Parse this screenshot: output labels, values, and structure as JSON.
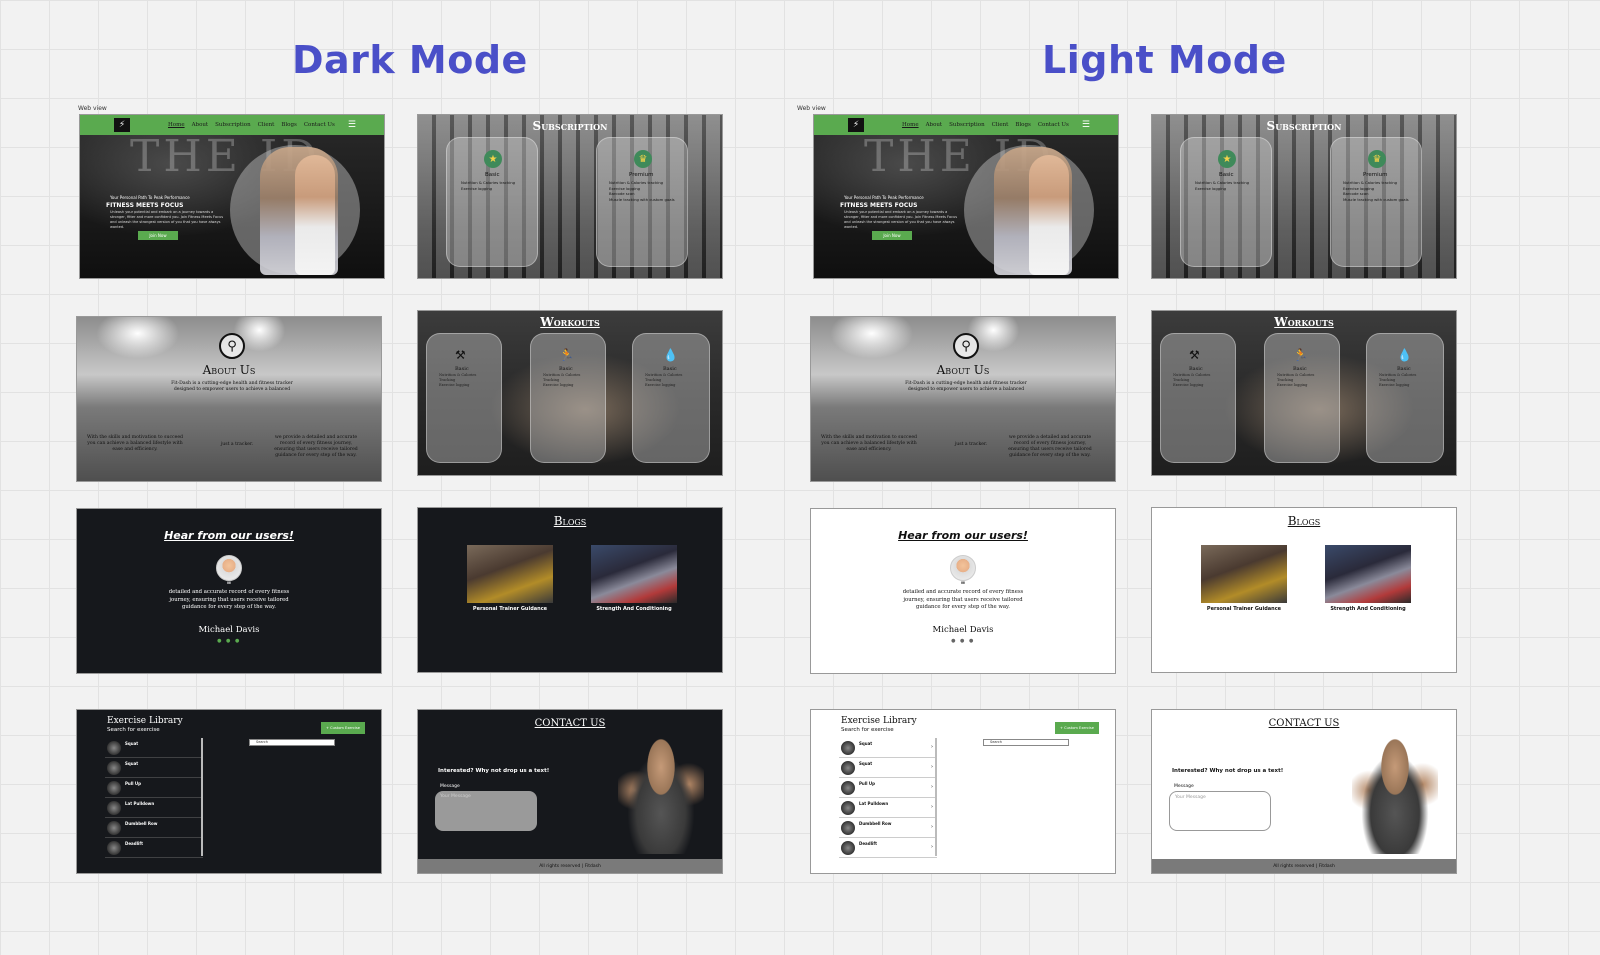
{
  "headings": {
    "dark": "Dark Mode",
    "light": "Light Mode"
  },
  "web_view_label": "Web view",
  "hero": {
    "nav_links": [
      "Home",
      "About",
      "Subscription",
      "Client",
      "Blogs",
      "Contact Us"
    ],
    "menu_icon": "☰",
    "big_text": "THE ID",
    "tagline": "Your Personal Path To Peak Performance",
    "headline": "FITNESS MEETS FOCUS",
    "body": "Unleash your potential and embark on a journey towards a stronger, fitter and more confident you. Join Fitness Meets Focus and unleash the strongest version of you that you have always wanted.",
    "button": "Join Now"
  },
  "subscription": {
    "title": "Subscription",
    "plans": [
      {
        "name": "Basic",
        "features": [
          "Nutrition & Calories tracking",
          "Exercise logging"
        ]
      },
      {
        "name": "Premium",
        "features": [
          "Nutrition & Calories tracking",
          "Exercise logging",
          "Barcode scan",
          "Muscle tracking with custom goals"
        ]
      }
    ]
  },
  "about": {
    "title": "About Us",
    "line1": "Fit-Dash is a cutting-edge health and fitness tracker",
    "line2": "designed to empower users to achieve a balanced",
    "left_text": "With the skills and motivation to succeed you can achieve a balanced lifestyle with ease and efficiency.",
    "middle_text": "just a tracker.",
    "right_text": "we provide a detailed and accurate record of every fitness journey, ensuring that users receive tailored guidance for every step of the way."
  },
  "workouts": {
    "title": "Workouts",
    "cards": [
      {
        "name": "Basic",
        "features": [
          "Nutrition & Calories",
          "Tracking",
          "Exercise logging"
        ]
      },
      {
        "name": "Basic",
        "features": [
          "Nutrition & Calories",
          "Tracking",
          "Exercise logging"
        ]
      },
      {
        "name": "Basic",
        "features": [
          "Nutrition & Calories",
          "Tracking",
          "Exercise logging"
        ]
      }
    ]
  },
  "testimonial": {
    "title": "Hear from our users!",
    "quote_mark": "\"",
    "text": "detailed and accurate record of every fitness journey, ensuring that users receive tailored guidance for every step of the way.",
    "name": "Michael Davis",
    "dots": "● ● ●"
  },
  "blogs": {
    "title": "Blogs",
    "posts": [
      "Personal Trainer Guidance",
      "Strength And Conditioning"
    ]
  },
  "library": {
    "title": "Exercise Library",
    "subtitle": "Search for exercise",
    "add_button": "+ Custom Exercise",
    "search_placeholder": "Search",
    "items": [
      "Squat",
      "Squat",
      "Pull Up",
      "Lat Pulldown",
      "Dumbbell Row",
      "Deadlift"
    ]
  },
  "contact": {
    "title": "CONTACT US",
    "lead": "Interested? Why not drop us a text!",
    "label": "Message",
    "placeholder": "Your Message",
    "footer": "All rights reserved | Fitdash"
  }
}
